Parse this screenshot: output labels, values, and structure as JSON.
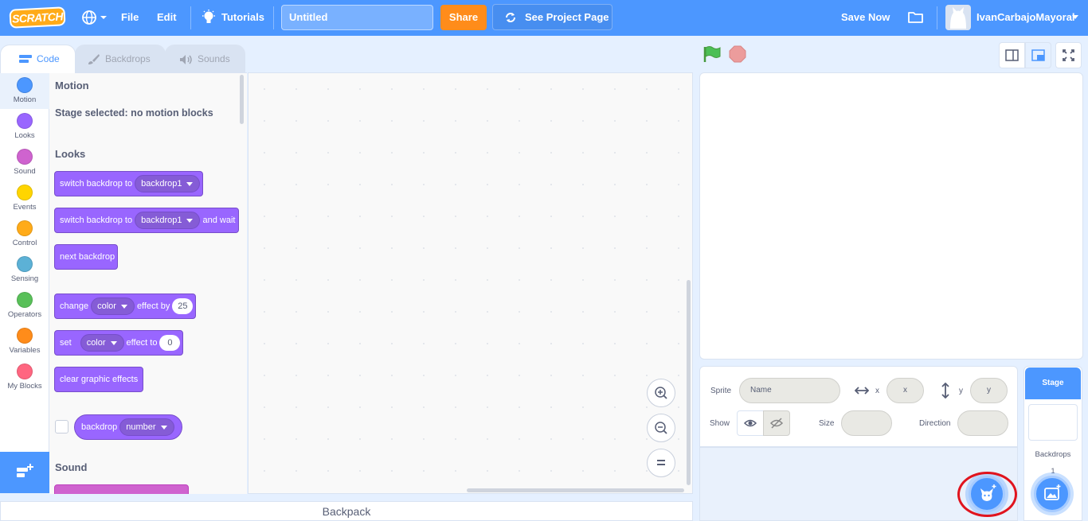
{
  "menubar": {
    "logo": "SCRATCH",
    "file": "File",
    "edit": "Edit",
    "tutorials": "Tutorials",
    "project_title": "Untitled",
    "share": "Share",
    "see_project_page": "See Project Page",
    "save_now": "Save Now",
    "username": "IvanCarbajoMayoral"
  },
  "tabs": {
    "code": "Code",
    "backdrops": "Backdrops",
    "sounds": "Sounds"
  },
  "categories": [
    {
      "label": "Motion",
      "color": "#4c97ff"
    },
    {
      "label": "Looks",
      "color": "#9966ff"
    },
    {
      "label": "Sound",
      "color": "#cf63cf"
    },
    {
      "label": "Events",
      "color": "#ffd500"
    },
    {
      "label": "Control",
      "color": "#ffab19"
    },
    {
      "label": "Sensing",
      "color": "#5cb1d6"
    },
    {
      "label": "Operators",
      "color": "#59c059"
    },
    {
      "label": "Variables",
      "color": "#ff8c1a"
    },
    {
      "label": "My Blocks",
      "color": "#ff6680"
    }
  ],
  "palette": {
    "motion_heading": "Motion",
    "motion_note": "Stage selected: no motion blocks",
    "looks_heading": "Looks",
    "switch_backdrop_to": "switch backdrop to",
    "backdrop_menu": "backdrop1",
    "and_wait": "and wait",
    "next_backdrop": "next backdrop",
    "change": "change",
    "effect_menu": "color",
    "effect_by": "effect by",
    "change_value": "25",
    "set": "set",
    "effect_to": "effect to",
    "set_value": "0",
    "clear_graphic_effects": "clear graphic effects",
    "backdrop": "backdrop",
    "number_menu": "number",
    "sound_heading": "Sound"
  },
  "backpack": "Backpack",
  "sprite_info": {
    "sprite": "Sprite",
    "name_placeholder": "Name",
    "x": "x",
    "x_placeholder": "x",
    "y": "y",
    "y_placeholder": "y",
    "show": "Show",
    "size": "Size",
    "direction": "Direction"
  },
  "stage_pane": {
    "title": "Stage",
    "backdrops": "Backdrops",
    "backdrop_count": "1"
  }
}
